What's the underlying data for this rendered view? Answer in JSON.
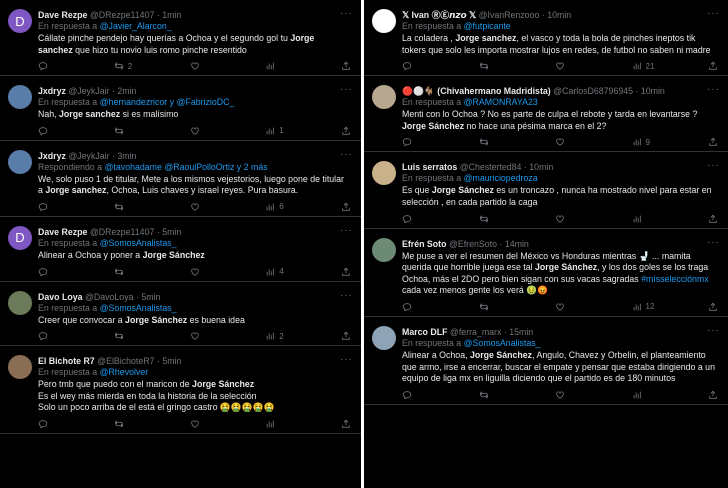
{
  "left": [
    {
      "name": "Dave Rezpe",
      "handle": "@DRezpe11407",
      "time": "1min",
      "reply_prefix": "En respuesta a ",
      "reply_to": "@Javier_Alarcon_",
      "body": [
        {
          "t": "Cállate pinche pendejo hay querías a Ochoa y el segundo gol tu "
        },
        {
          "b": "Jorge sanchez"
        },
        {
          "t": " que hizo tu novio luis romo pinche resentido"
        }
      ],
      "retweets": "2",
      "likes": "",
      "views": "",
      "avatar_letter": "D",
      "avatar_color": "#7e57c2"
    },
    {
      "name": "Jxdryz",
      "handle": "@JeykJair",
      "time": "2min",
      "reply_prefix": "En respuesta a ",
      "reply_to": "@hernandezricor y @FabrizioDC_",
      "body": [
        {
          "t": "Nah, "
        },
        {
          "b": "Jorge sanchez"
        },
        {
          "t": " si es malísimo"
        }
      ],
      "retweets": "",
      "likes": "",
      "views": "1",
      "avatar_letter": "",
      "avatar_color": "#5a7ca8"
    },
    {
      "name": "Jxdryz",
      "handle": "@JeykJair",
      "time": "3min",
      "reply_prefix": "Respondiendo a ",
      "reply_to": "@tavohadame @RaoulPolloOrtiz y 2 más",
      "body": [
        {
          "t": "We, solo puso 1 de titular, Mete a los mismos vejestorios, luego pone de titular a "
        },
        {
          "b": "Jorge sanchez"
        },
        {
          "t": ", Ochoa, Luis chaves y israel reyes. Pura basura."
        }
      ],
      "retweets": "",
      "likes": "",
      "views": "6",
      "avatar_letter": "",
      "avatar_color": "#5a7ca8"
    },
    {
      "name": "Dave Rezpe",
      "handle": "@DRezpe11407",
      "time": "5min",
      "reply_prefix": "En respuesta a ",
      "reply_to": "@SomosAnalistas_",
      "body": [
        {
          "t": "Alinear a Ochoa y poner a "
        },
        {
          "b": "Jorge Sánchez"
        }
      ],
      "retweets": "",
      "likes": "",
      "views": "4",
      "avatar_letter": "D",
      "avatar_color": "#7e57c2"
    },
    {
      "name": "Davo Loya",
      "handle": "@DavoLoya",
      "time": "5min",
      "reply_prefix": "En respuesta a ",
      "reply_to": "@SomosAnalistas_",
      "body": [
        {
          "t": "Creer que convocar a "
        },
        {
          "b": "Jorge Sánchez"
        },
        {
          "t": " es buena idea"
        }
      ],
      "retweets": "",
      "likes": "",
      "views": "2",
      "avatar_letter": "",
      "avatar_color": "#6b7b5a"
    },
    {
      "name": "El Bichote R7",
      "handle": "@ElBichoteR7",
      "time": "5min",
      "reply_prefix": "En respuesta a ",
      "reply_to": "@Rhevolver",
      "body": [
        {
          "t": "Pero tmb que puedo con el maricon de "
        },
        {
          "b": "Jorge Sánchez"
        },
        {
          "t": "\nEs el wey más mierda en toda la historia de la selección\nSolo un poco arriba de el está el gringo castro 🤮🤮🤮🤮🤮"
        }
      ],
      "retweets": "",
      "likes": "",
      "views": "",
      "avatar_letter": "",
      "avatar_color": "#8a6d55"
    }
  ],
  "right": [
    {
      "name": "𝕏 Ivan ⓇⒺ𝙣𝙯𝙤 𝕏",
      "handle": "@IvanRenzooo",
      "time": "10min",
      "reply_prefix": "En respuesta a ",
      "reply_to": "@futpicante",
      "body": [
        {
          "t": "La coladera , "
        },
        {
          "b": "Jorge sanchez"
        },
        {
          "t": ", el vasco y toda la bola de pinches ineptos tik tokers que solo les importa mostrar lujos en redes, de futbol no saben ni madre"
        }
      ],
      "retweets": "",
      "likes": "",
      "views": "21",
      "avatar_letter": "",
      "avatar_color": "#ffffff"
    },
    {
      "name": "🔴⚪🐐 (Chivahermano Madridista)",
      "handle": "@CarlosD68796945",
      "time": "10min",
      "reply_prefix": "En respuesta a ",
      "reply_to": "@RAMONRAYA23",
      "body": [
        {
          "t": "Menti con lo Ochoa ? No es parte de culpa el rebote y tarda en levantarse ? "
        },
        {
          "b": "Jorge Sánchez"
        },
        {
          "t": " no hace una pésima marca en el 2?"
        }
      ],
      "retweets": "",
      "likes": "",
      "views": "9",
      "avatar_letter": "",
      "avatar_color": "#b8a790"
    },
    {
      "name": "Luis serratos",
      "handle": "@Chesterted84",
      "time": "10min",
      "reply_prefix": "En respuesta a ",
      "reply_to": "@mauriciopedroza",
      "body": [
        {
          "t": "Es que "
        },
        {
          "b": "Jorge Sánchez"
        },
        {
          "t": " es un troncazo , nunca ha mostrado nivel para estar en selección , en cada partido la caga"
        }
      ],
      "retweets": "",
      "likes": "",
      "views": "",
      "avatar_letter": "",
      "avatar_color": "#c9b28a"
    },
    {
      "name": "Efrén Soto",
      "handle": "@EfrenSoto",
      "time": "14min",
      "reply_prefix": "",
      "reply_to": "",
      "body": [
        {
          "t": "Me puse a ver el resumen del México vs Honduras mientras 🚽 ... mamita querida que horrible juega ese tal "
        },
        {
          "b": "Jorge Sánchez"
        },
        {
          "t": ", y los dos goles se los traga Ochoa, más el 2DO pero bien sigan con sus vacas sagradas "
        },
        {
          "m": "#mísselecciónmx"
        },
        {
          "t": " cada vez menos gente los verá 🤢😡"
        }
      ],
      "retweets": "",
      "likes": "",
      "views": "12",
      "avatar_letter": "",
      "avatar_color": "#6d8a74"
    },
    {
      "name": "Marco DLF",
      "handle": "@ferra_marx",
      "time": "15min",
      "reply_prefix": "En respuesta a ",
      "reply_to": "@SomosAnalistas_",
      "body": [
        {
          "t": "Alinear a Ochoa, "
        },
        {
          "b": "Jorge Sánchez"
        },
        {
          "t": ", Angulo, Chavez y Orbelin, el planteamiento que armo, irse a encerrar, buscar el empate y pensar que estaba dirigiendo a un equipo de liga mx en liguilla diciendo que el partido es de 180 minutos"
        }
      ],
      "retweets": "",
      "likes": "",
      "views": "",
      "avatar_letter": "",
      "avatar_color": "#8fa3b6"
    }
  ]
}
